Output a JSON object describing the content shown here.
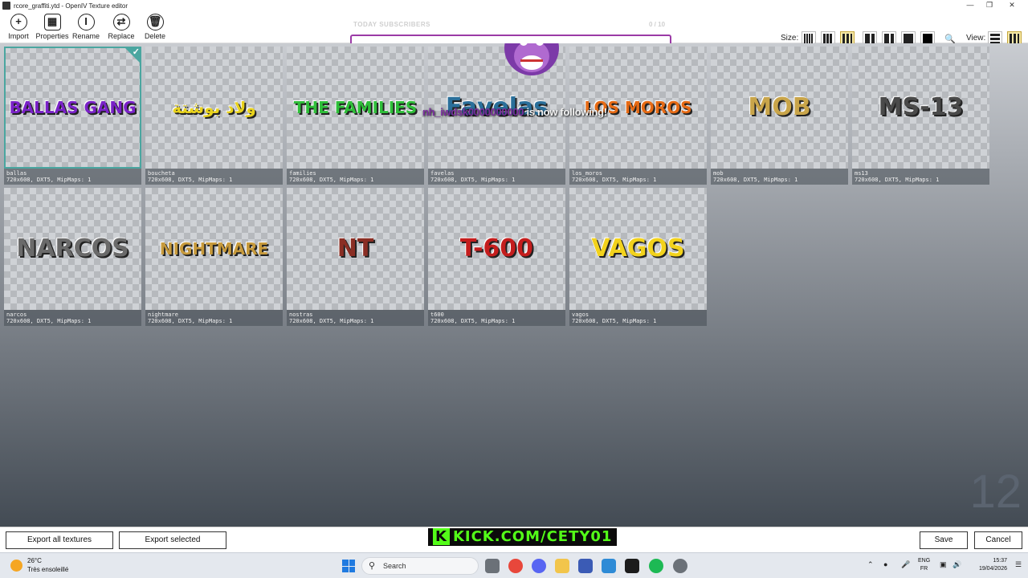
{
  "window": {
    "title": "rcore_graffiti.ytd - OpenIV Texture editor"
  },
  "toolbar": {
    "import": "Import",
    "properties": "Properties",
    "rename": "Rename",
    "replace": "Replace",
    "delete": "Delete",
    "size_label": "Size:",
    "view_label": "View:"
  },
  "stream_overlay": {
    "label": "TODAY SUBSCRIBERS",
    "count": "0 / 10",
    "follower": "nh_iwdsk0000000000",
    "follow_text": "is now following!",
    "kick_text": "KICK.COM/CETY01",
    "kick_logo": "K"
  },
  "textures": [
    {
      "name": "ballas",
      "info": "720x608, DXT5, MipMaps: 1",
      "art": "BALLAS GANG",
      "color": "#7a22c8"
    },
    {
      "name": "boucheta",
      "info": "720x608, DXT5, MipMaps: 1",
      "art": "ولاد بوشتة",
      "color": "#e8d21c"
    },
    {
      "name": "families",
      "info": "720x608, DXT5, MipMaps: 1",
      "art": "THE FAMILIES",
      "color": "#2fbf3a"
    },
    {
      "name": "favelas",
      "info": "720x608, DXT5, MipMaps: 1",
      "art": "Favelas",
      "color": "#2a6f9a"
    },
    {
      "name": "los_moros",
      "info": "720x608, DXT5, MipMaps: 1",
      "art": "LOS MOROS",
      "color": "#e66a14"
    },
    {
      "name": "mob",
      "info": "720x608, DXT5, MipMaps: 1",
      "art": "MOB",
      "color": "#c9a54a"
    },
    {
      "name": "ms13",
      "info": "720x608, DXT5, MipMaps: 1",
      "art": "MS-13",
      "color": "#4a4a4a"
    },
    {
      "name": "narcos",
      "info": "720x608, DXT5, MipMaps: 1",
      "art": "NARCOS",
      "color": "#6a6a6a"
    },
    {
      "name": "nightmare",
      "info": "720x608, DXT5, MipMaps: 1",
      "art": "NIGHTMARE",
      "color": "#c79a3c"
    },
    {
      "name": "nostras",
      "info": "720x608, DXT5, MipMaps: 1",
      "art": "NT",
      "color": "#8a2e24"
    },
    {
      "name": "t600",
      "info": "720x608, DXT5, MipMaps: 1",
      "art": "T-600",
      "color": "#c41d1d"
    },
    {
      "name": "vagos",
      "info": "720x608, DXT5, MipMaps: 1",
      "art": "VAGOS",
      "color": "#f2d21c"
    }
  ],
  "texture_count": "12",
  "bottom": {
    "export_all": "Export all textures",
    "export_selected": "Export selected",
    "save": "Save",
    "cancel": "Cancel"
  },
  "taskbar": {
    "temp": "26°C",
    "weather": "Très ensoleillé",
    "search": "Search",
    "lang1": "ENG",
    "lang2": "FR",
    "time": "15:37",
    "date": "19/04/2026"
  }
}
